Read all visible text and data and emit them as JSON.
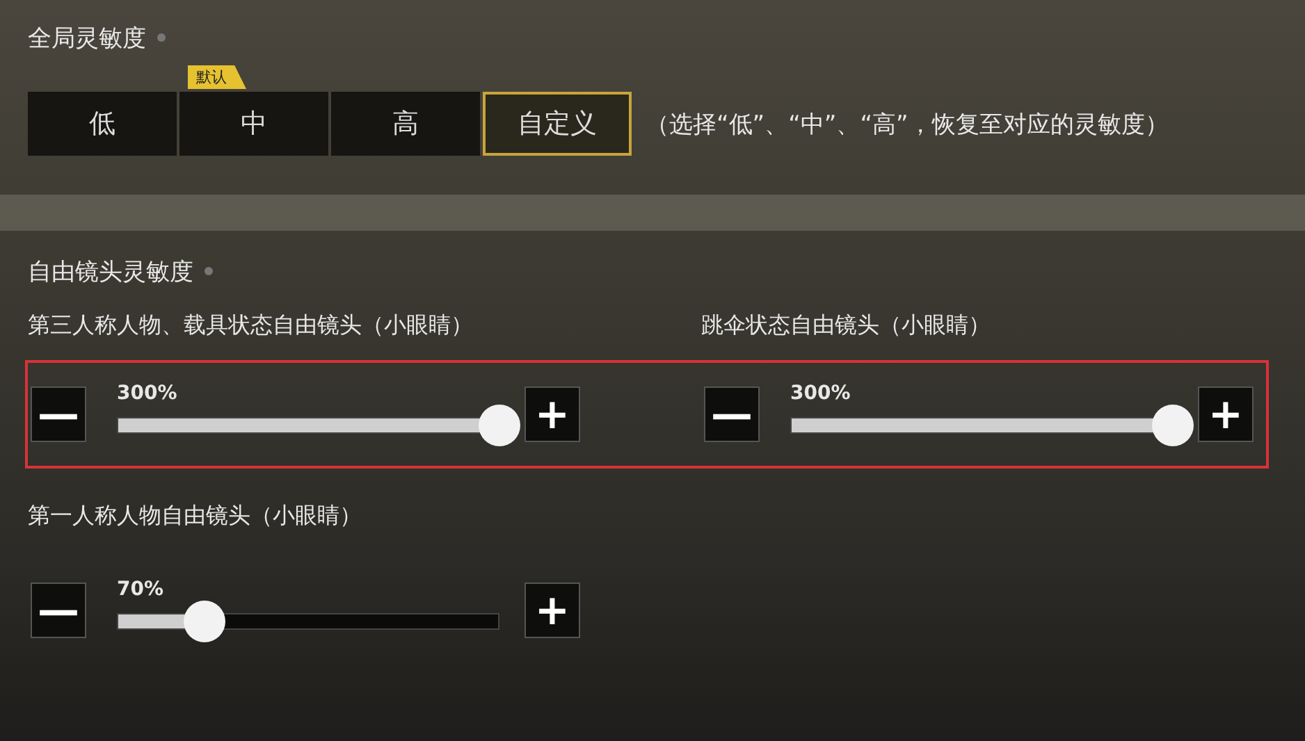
{
  "global_sensitivity": {
    "title": "全局灵敏度",
    "badge": "默认",
    "presets": [
      {
        "label": "低",
        "selected": false,
        "default": false
      },
      {
        "label": "中",
        "selected": false,
        "default": true
      },
      {
        "label": "高",
        "selected": false,
        "default": false
      },
      {
        "label": "自定义",
        "selected": true,
        "default": false
      }
    ],
    "hint": "（选择“低”、“中”、“高”，恢复至对应的灵敏度）"
  },
  "free_camera_sensitivity": {
    "title": "自由镜头灵敏度",
    "groups": [
      {
        "highlighted": true,
        "sliders": [
          {
            "label": "第三人称人物、载具状态自由镜头（小眼睛）",
            "reading": "300%",
            "level": 1,
            "minus": "—",
            "plus": "+"
          },
          {
            "label": "跳伞状态自由镜头（小眼睛）",
            "reading": "300%",
            "level": 1,
            "minus": "—",
            "plus": "+"
          }
        ]
      },
      {
        "highlighted": false,
        "sliders": [
          {
            "label": "第一人称人物自由镜头（小眼睛）",
            "reading": "70%",
            "level": 0.23,
            "minus": "—",
            "plus": "+"
          }
        ]
      }
    ]
  }
}
